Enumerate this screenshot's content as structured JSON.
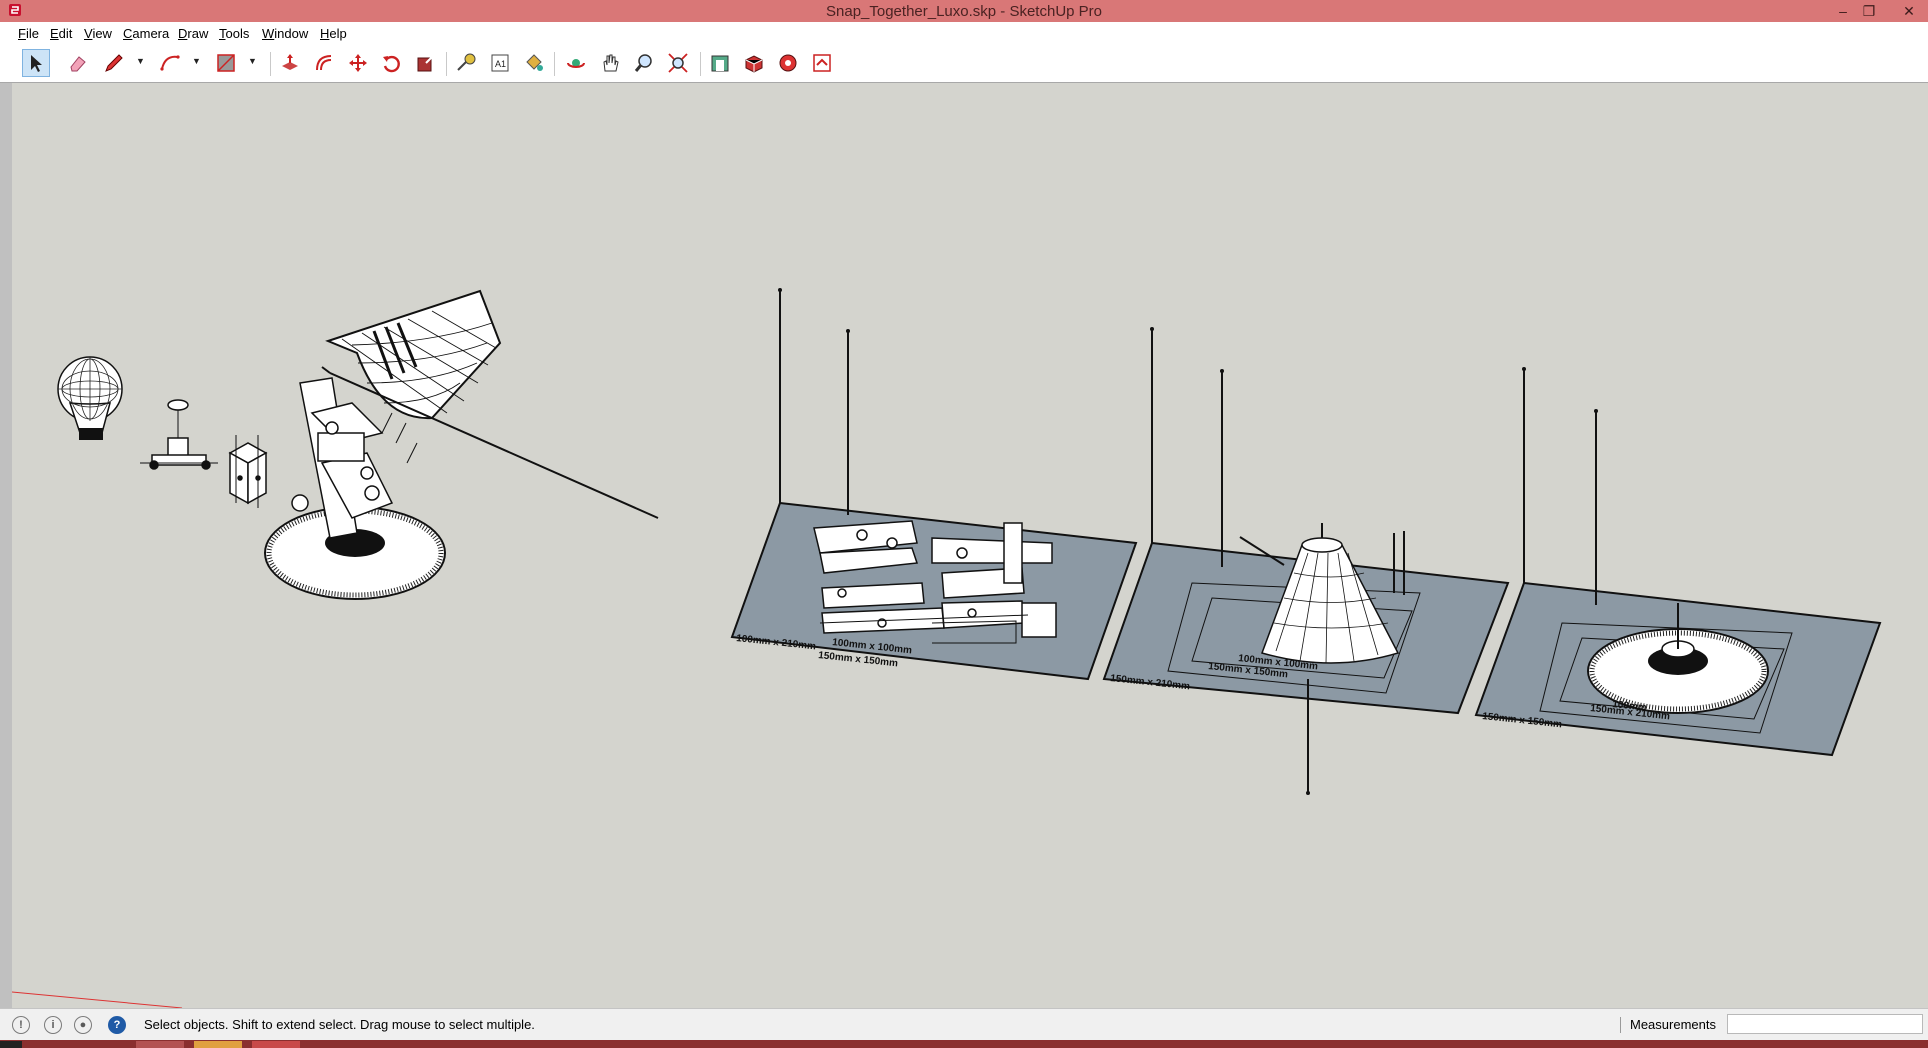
{
  "window": {
    "title": "Snap_Together_Luxo.skp - SketchUp Pro",
    "controls": [
      "minimize-icon",
      "restore-icon",
      "close-icon"
    ],
    "titlebar_color": "#d97777"
  },
  "menu": {
    "items": [
      {
        "label": "File",
        "u": "F",
        "rest": "ile"
      },
      {
        "label": "Edit",
        "u": "E",
        "rest": "dit"
      },
      {
        "label": "View",
        "u": "V",
        "rest": "iew"
      },
      {
        "label": "Camera",
        "u": "C",
        "rest": "amera"
      },
      {
        "label": "Draw",
        "u": "D",
        "rest": "raw"
      },
      {
        "label": "Tools",
        "u": "T",
        "rest": "ools"
      },
      {
        "label": "Window",
        "u": "W",
        "rest": "indow"
      },
      {
        "label": "Help",
        "u": "H",
        "rest": "elp"
      }
    ]
  },
  "toolbar": {
    "tools": [
      "select-tool-icon",
      "eraser-tool-icon",
      "pencil-line-tool-icon",
      "arc-tool-icon",
      "rectangle-tool-icon",
      "push-pull-tool-icon",
      "offset-tool-icon",
      "move-tool-icon",
      "rotate-tool-icon",
      "scale-tool-icon",
      "tape-measure-tool-icon",
      "text-tool-icon",
      "paint-bucket-tool-icon",
      "orbit-tool-icon",
      "pan-tool-icon",
      "zoom-tool-icon",
      "zoom-extents-tool-icon",
      "3d-warehouse-icon",
      "extension-warehouse-icon",
      "layout-icon",
      "extension-manager-icon"
    ],
    "active_tool": "select-tool-icon"
  },
  "viewport": {
    "background": "#d4d4ce",
    "plate_color": "#8c99a4",
    "plate_labels": [
      "100mm x 210mm",
      "100mm x 100mm",
      "150mm x 150mm",
      "150mm x 210mm",
      "100mm x 100mm",
      "150mm x 150mm",
      "150mm x 210mm",
      "100mm",
      "150mm x 150mm"
    ]
  },
  "status": {
    "icons": [
      "geo-location-icon",
      "credits-icon",
      "user-account-icon",
      "help-icon"
    ],
    "text": "Select objects. Shift to extend select. Drag mouse to select multiple.",
    "measurements_label": "Measurements",
    "measurements_value": ""
  },
  "taskbar": {
    "color": "#8a2f2f"
  }
}
